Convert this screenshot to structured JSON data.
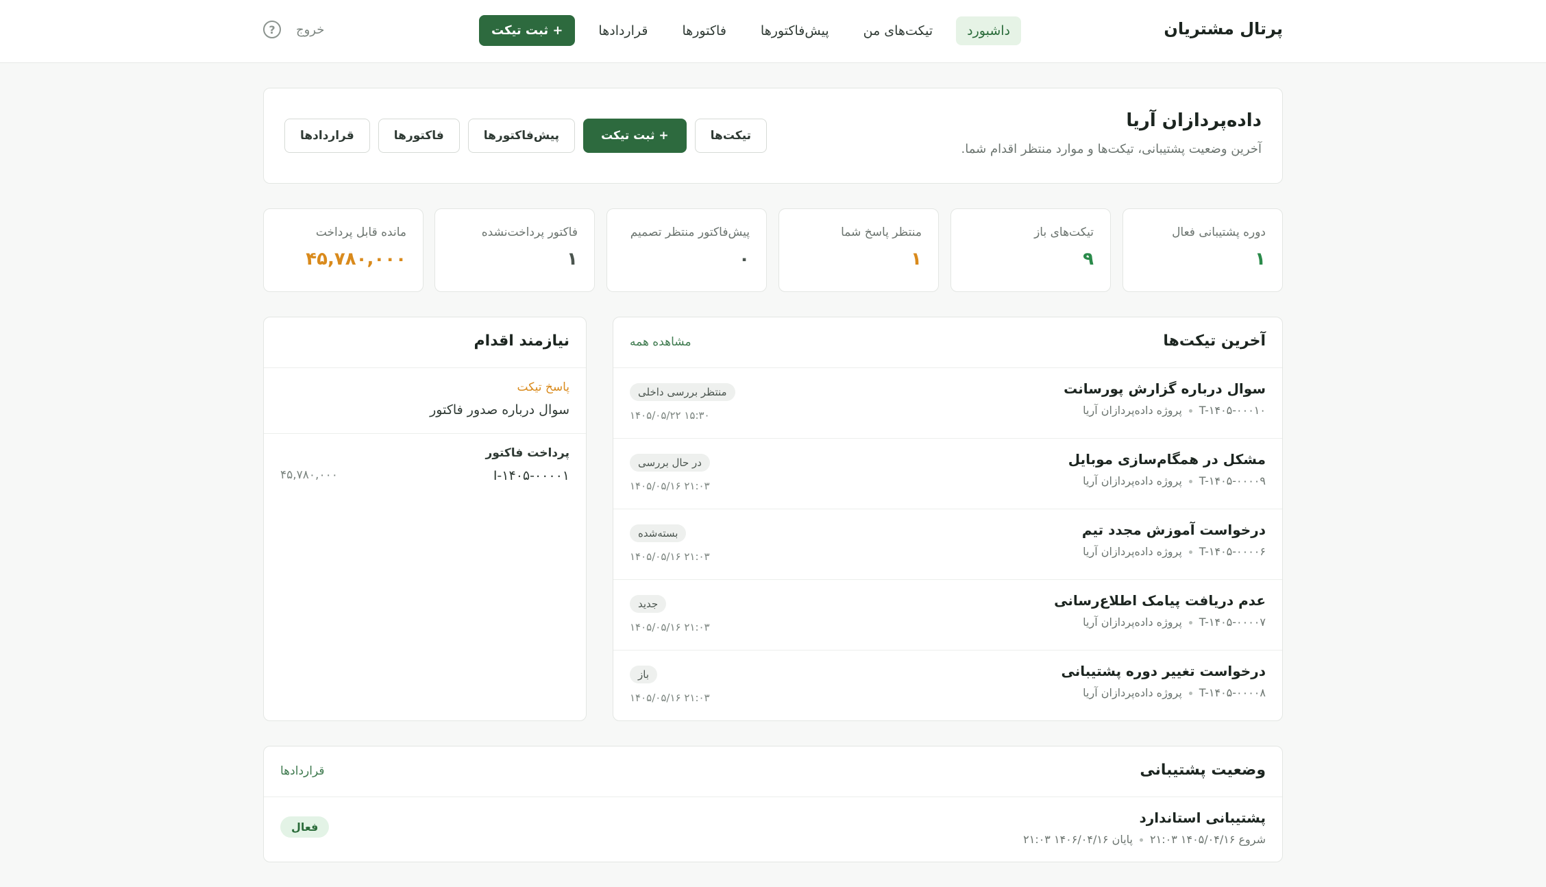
{
  "header": {
    "brand": "پرتال مشتریان",
    "nav": [
      {
        "label": "داشبورد",
        "active": true
      },
      {
        "label": "تیکت‌های من"
      },
      {
        "label": "پیش‌فاکتورها"
      },
      {
        "label": "فاکتورها"
      },
      {
        "label": "قراردادها"
      }
    ],
    "new_ticket": "+ ثبت تیکت",
    "help_icon": "question-circle-icon",
    "logout": "خروج"
  },
  "hero": {
    "title": "داده‌پردازان آریا",
    "subtitle": "آخرین وضعیت پشتیبانی، تیکت‌ها و موارد منتظر اقدام شما.",
    "buttons": {
      "tickets": "تیکت‌ها",
      "new_ticket": "+ ثبت تیکت",
      "proformas": "پیش‌فاکتورها",
      "invoices": "فاکتورها",
      "contracts": "قراردادها"
    }
  },
  "stats": [
    {
      "label": "دوره پشتیبانی فعال",
      "value": "۱",
      "color": "#2a8a4a"
    },
    {
      "label": "تیکت‌های باز",
      "value": "۹",
      "color": "#2a8a4a"
    },
    {
      "label": "منتظر پاسخ شما",
      "value": "۱",
      "color": "#d98a1c"
    },
    {
      "label": "پیش‌فاکتور منتظر تصمیم",
      "value": "۰",
      "color": "#4b554f"
    },
    {
      "label": "فاکتور پرداخت‌نشده",
      "value": "۱",
      "color": "#4b554f"
    },
    {
      "label": "مانده قابل پرداخت",
      "value": "۴۵,۷۸۰,۰۰۰",
      "color": "#d98a1c"
    }
  ],
  "tickets": {
    "title": "آخرین تیکت‌ها",
    "view_all": "مشاهده همه",
    "rows": [
      {
        "title": "سوال درباره گزارش پورسانت",
        "code": "T-۱۴۰۵-۰۰۰۱۰",
        "project": "پروژه داده‌پردازان آریا",
        "status": "منتظر بررسی داخلی",
        "date": "۱۴۰۵/۰۵/۲۲ ۱۵:۳۰"
      },
      {
        "title": "مشکل در همگام‌سازی موبایل",
        "code": "T-۱۴۰۵-۰۰۰۰۹",
        "project": "پروژه داده‌پردازان آریا",
        "status": "در حال بررسی",
        "date": "۱۴۰۵/۰۵/۱۶ ۲۱:۰۳"
      },
      {
        "title": "درخواست آموزش مجدد تیم",
        "code": "T-۱۴۰۵-۰۰۰۰۶",
        "project": "پروژه داده‌پردازان آریا",
        "status": "بسته‌شده",
        "date": "۱۴۰۵/۰۵/۱۶ ۲۱:۰۳"
      },
      {
        "title": "عدم دریافت پیامک اطلاع‌رسانی",
        "code": "T-۱۴۰۵-۰۰۰۰۷",
        "project": "پروژه داده‌پردازان آریا",
        "status": "جدید",
        "date": "۱۴۰۵/۰۵/۱۶ ۲۱:۰۳"
      },
      {
        "title": "درخواست تغییر دوره پشتیبانی",
        "code": "T-۱۴۰۵-۰۰۰۰۸",
        "project": "پروژه داده‌پردازان آریا",
        "status": "باز",
        "date": "۱۴۰۵/۰۵/۱۶ ۲۱:۰۳"
      }
    ]
  },
  "actions": {
    "title": "نیازمند اقدام",
    "items": [
      {
        "tag": "پاسخ تیکت",
        "text": "سوال درباره صدور فاکتور",
        "amount": "",
        "tag_color": "#d98a1c"
      },
      {
        "tag": "پرداخت فاکتور",
        "text": "I-۱۴۰۵-۰۰۰۰۱",
        "amount": "۴۵,۷۸۰,۰۰۰",
        "tag_color": "#2f3a34"
      }
    ]
  },
  "support": {
    "title": "وضعیت پشتیبانی",
    "link": "قراردادها",
    "plan": "پشتیبانی استاندارد",
    "start": "شروع ۱۴۰۵/۰۴/۱۶ ۲۱:۰۳",
    "end": "پایان ۱۴۰۶/۰۴/۱۶ ۲۱:۰۳",
    "status": "فعال"
  }
}
